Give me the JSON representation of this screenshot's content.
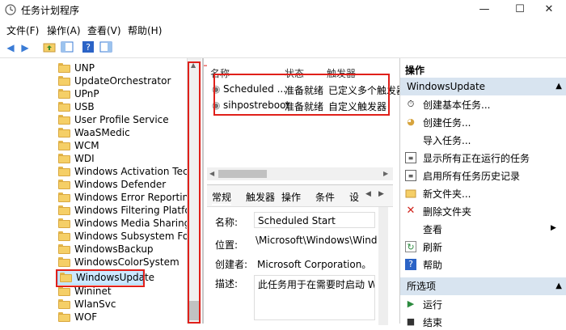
{
  "window": {
    "title": "任务计划程序",
    "min": "—",
    "max": "☐",
    "close": "✕"
  },
  "menu": {
    "file": "文件(F)",
    "action": "操作(A)",
    "view": "查看(V)",
    "help": "帮助(H)"
  },
  "tree": {
    "items": [
      {
        "label": "UNP"
      },
      {
        "label": "UpdateOrchestrator"
      },
      {
        "label": "UPnP"
      },
      {
        "label": "USB"
      },
      {
        "label": "User Profile Service"
      },
      {
        "label": "WaaSMedic"
      },
      {
        "label": "WCM"
      },
      {
        "label": "WDI"
      },
      {
        "label": "Windows Activation Techno"
      },
      {
        "label": "Windows Defender"
      },
      {
        "label": "Windows Error Reporting"
      },
      {
        "label": "Windows Filtering Platform"
      },
      {
        "label": "Windows Media Sharing"
      },
      {
        "label": "Windows Subsystem For Lin"
      },
      {
        "label": "WindowsBackup"
      },
      {
        "label": "WindowsColorSystem"
      },
      {
        "label": "WindowsUpdate"
      },
      {
        "label": "Wininet"
      },
      {
        "label": "WlanSvc"
      },
      {
        "label": "WOF"
      }
    ]
  },
  "list": {
    "col_name": "名称",
    "col_status": "状态",
    "col_trigger": "触发器",
    "rows": [
      {
        "name": "Scheduled ...",
        "status": "准备就绪",
        "trigger": "已定义多个触发器"
      },
      {
        "name": "sihpostreboot",
        "status": "准备就绪",
        "trigger": "自定义触发器"
      }
    ]
  },
  "details": {
    "tabs": [
      "常规",
      "触发器",
      "操作",
      "条件",
      "设"
    ],
    "name_label": "名称:",
    "name_value": "Scheduled Start",
    "location_label": "位置:",
    "location_value": "\\Microsoft\\Windows\\Windows",
    "author_label": "创建者:",
    "author_value": "Microsoft Corporation。",
    "desc_label": "描述:",
    "desc_value": "此任务用于在需要时启动 Winc"
  },
  "actions": {
    "header": "操作",
    "section1": "WindowsUpdate",
    "items1": [
      {
        "label": "创建基本任务...",
        "icon": "clock-icon"
      },
      {
        "label": "创建任务...",
        "icon": "task-icon"
      },
      {
        "label": "导入任务...",
        "icon": "import-icon"
      },
      {
        "label": "显示所有正在运行的任务",
        "icon": "list-icon"
      },
      {
        "label": "启用所有任务历史记录",
        "icon": "history-icon"
      },
      {
        "label": "新文件夹...",
        "icon": "folder-icon"
      },
      {
        "label": "删除文件夹",
        "icon": "delete-icon"
      },
      {
        "label": "查看",
        "icon": "view-icon"
      },
      {
        "label": "刷新",
        "icon": "refresh-icon"
      },
      {
        "label": "帮助",
        "icon": "help-icon"
      }
    ],
    "section2": "所选项",
    "items2": [
      {
        "label": "运行",
        "icon": "run-icon"
      },
      {
        "label": "结束",
        "icon": "stop-icon"
      }
    ]
  },
  "colors": {
    "highlight_red": "#e0201a",
    "selection": "#cce8ff",
    "section_header": "#d8e4f0"
  }
}
